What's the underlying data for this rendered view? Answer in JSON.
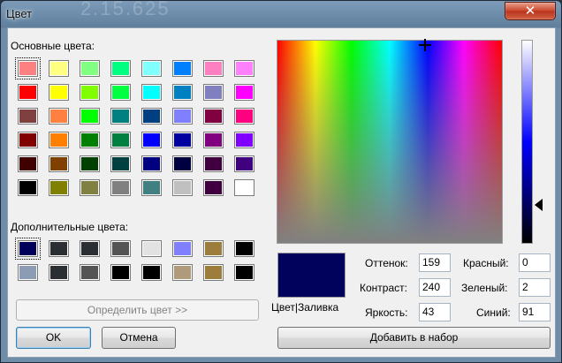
{
  "window": {
    "title": "Цвет",
    "close_glyph": "✕",
    "background_text": "2.15.625"
  },
  "basic_colors": {
    "label": "Основные цвета:",
    "colors": [
      "#ff8080",
      "#ffff80",
      "#80ff80",
      "#00ff80",
      "#80ffff",
      "#0080ff",
      "#ff80c0",
      "#ff80ff",
      "#ff0000",
      "#ffff00",
      "#80ff00",
      "#00ff40",
      "#00ffff",
      "#0080c0",
      "#8080c0",
      "#ff00ff",
      "#804040",
      "#ff8040",
      "#00ff00",
      "#008080",
      "#004080",
      "#8080ff",
      "#800040",
      "#ff0080",
      "#800000",
      "#ff8000",
      "#008000",
      "#008040",
      "#0000ff",
      "#0000a0",
      "#800080",
      "#8000ff",
      "#400000",
      "#804000",
      "#004000",
      "#004040",
      "#000080",
      "#000040",
      "#400040",
      "#400080",
      "#000000",
      "#808000",
      "#808040",
      "#808080",
      "#408080",
      "#c0c0c0",
      "#400040",
      "#ffffff"
    ]
  },
  "custom_colors": {
    "label": "Дополнительные цвета:",
    "colors": [
      "#00005b",
      "#2b2f33",
      "#2b2f33",
      "#545454",
      "#e2e2e2",
      "#8080ff",
      "#9c7d3c",
      "#000000",
      "#8c9cb4",
      "#2b2f33",
      "#545454",
      "#000000",
      "#000000",
      "#b09a7c",
      "#9c7d3c",
      "#000000"
    ]
  },
  "current_color": {
    "hex": "#00025b",
    "label": "Цвет|Заливка"
  },
  "fields": {
    "hue_label": "Оттенок:",
    "hue": "159",
    "sat_label": "Контраст:",
    "sat": "240",
    "lum_label": "Яркость:",
    "lum": "43",
    "red_label": "Красный:",
    "red": "0",
    "green_label": "Зеленый:",
    "green": "2",
    "blue_label": "Синий:",
    "blue": "91"
  },
  "buttons": {
    "define": "Определить цвет >>",
    "ok": "OK",
    "cancel": "Отмена",
    "add": "Добавить в набор"
  }
}
